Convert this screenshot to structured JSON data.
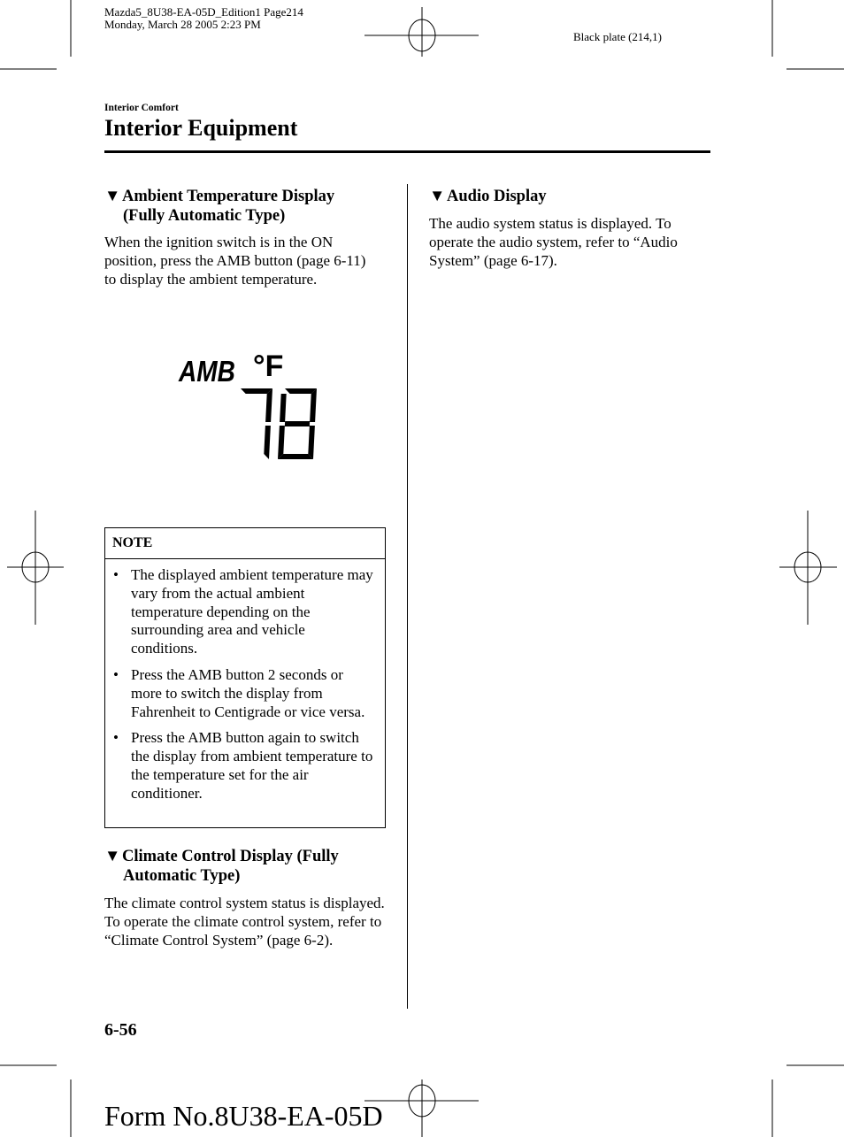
{
  "header": {
    "file_line": "Mazda5_8U38-EA-05D_Edition1 Page214",
    "date_line": "Monday, March 28 2005 2:23 PM",
    "plate": "Black plate (214,1)"
  },
  "section": {
    "category": "Interior Comfort",
    "title": "Interior Equipment"
  },
  "left": {
    "ambient": {
      "marker": "▼",
      "title_1": "Ambient Temperature Display",
      "title_2": "(Fully Automatic Type)",
      "text": "When the ignition switch is in the ON position, press the AMB button (page 6-11) to display the ambient temperature."
    },
    "display": {
      "label": "AMB",
      "unit": "°F",
      "value": "78"
    },
    "note": {
      "title": "NOTE",
      "items": [
        "The displayed ambient temperature may vary from the actual ambient temperature depending on the surrounding area and vehicle conditions.",
        "Press the AMB button 2 seconds or more to switch the display from Fahrenheit to Centigrade or vice versa.",
        "Press the AMB button again to switch the display from ambient temperature to the temperature set for the air conditioner."
      ]
    },
    "climate": {
      "marker": "▼",
      "title_1": "Climate Control Display (Fully",
      "title_2": "Automatic Type)",
      "text": "The climate control system status is displayed. To operate the climate control system, refer to “Climate Control System” (page 6-2)."
    }
  },
  "right": {
    "audio": {
      "marker": "▼",
      "title": "Audio Display",
      "text": "The audio system status is displayed. To operate the audio system, refer to “Audio System” (page 6-17)."
    }
  },
  "footer": {
    "page_number": "6-56",
    "form_number": "Form No.8U38-EA-05D"
  }
}
